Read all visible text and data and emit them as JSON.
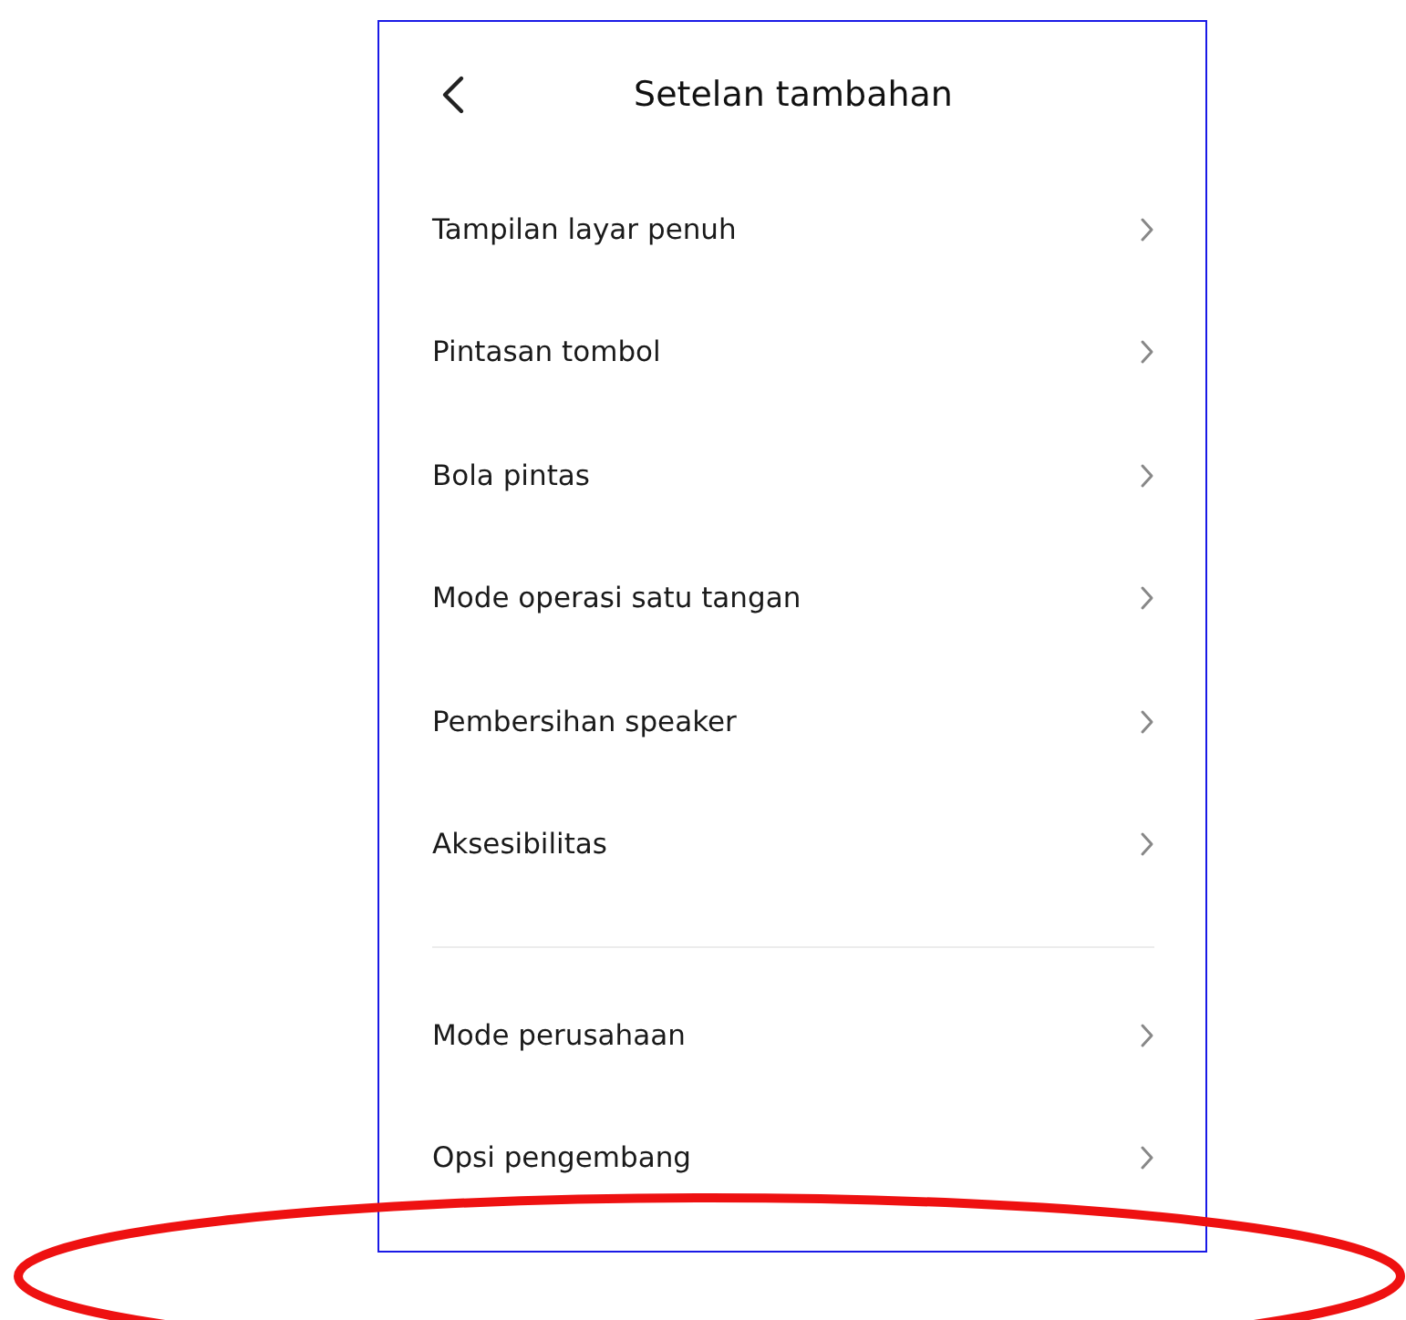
{
  "header": {
    "title": "Setelan tambahan"
  },
  "sections": [
    {
      "items": [
        {
          "label": "Tampilan layar penuh"
        },
        {
          "label": "Pintasan tombol"
        },
        {
          "label": "Bola pintas"
        },
        {
          "label": "Mode operasi satu tangan"
        },
        {
          "label": "Pembersihan speaker"
        },
        {
          "label": "Aksesibilitas"
        }
      ]
    },
    {
      "items": [
        {
          "label": "Mode perusahaan"
        },
        {
          "label": "Opsi pengembang"
        }
      ]
    }
  ]
}
